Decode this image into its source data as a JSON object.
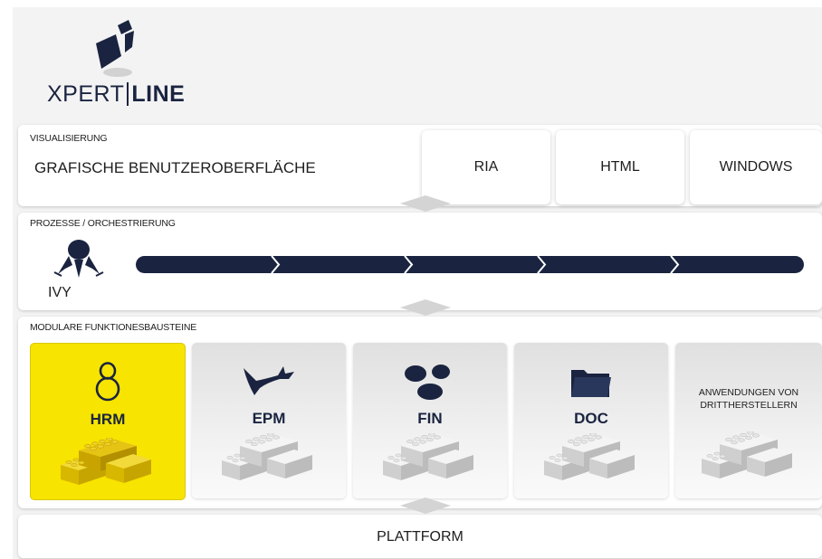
{
  "logo": {
    "part1": "XPERT",
    "part2": "LINE"
  },
  "visualisierung": {
    "label": "VISUALISIERUNG",
    "title": "GRAFISCHE BENUTZEROBERFLÄCHE",
    "tabs": [
      "RIA",
      "HTML",
      "WINDOWS"
    ]
  },
  "prozesse": {
    "label": "PROZESSE / ORCHESTRIERUNG",
    "engine": "IVY",
    "steps": 5
  },
  "module": {
    "label": "MODULARE FUNKTIONESBAUSTEINE",
    "tiles": [
      {
        "name": "HRM",
        "icon": "person-icon",
        "active": true
      },
      {
        "name": "EPM",
        "icon": "plane-icon",
        "active": false
      },
      {
        "name": "FIN",
        "icon": "coins-icon",
        "active": false
      },
      {
        "name": "DOC",
        "icon": "folder-icon",
        "active": false
      },
      {
        "name_line1": "ANWENDUNGEN VON",
        "name_line2": "DRITTHERSTELLERN",
        "active": false
      }
    ]
  },
  "plattform": {
    "label": "PLATTFORM"
  },
  "colors": {
    "navy": "#1a2440",
    "highlight": "#f7e400",
    "brick_grey": "#d0d0d0",
    "brick_yellow": "#d8b700"
  }
}
